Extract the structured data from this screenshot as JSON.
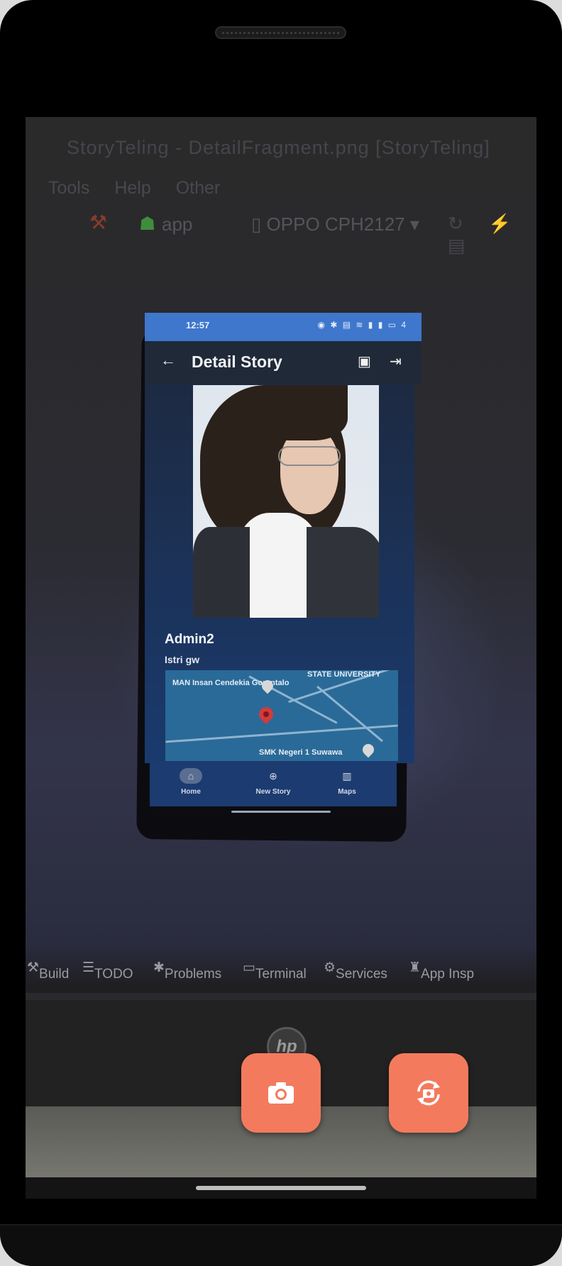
{
  "ide": {
    "title": "StoryTeling - DetailFragment.png [StoryTeling]",
    "menu": [
      "Tools",
      "Help",
      "Other"
    ],
    "run_config": "app",
    "device": "OPPO CPH2127",
    "bottom_tabs": [
      "Build",
      "TODO",
      "Problems",
      "Terminal",
      "Services",
      "App Insp"
    ]
  },
  "phone": {
    "status_time": "12:57",
    "status_icons": "◉ ✱ ▤ ≋ ▮ ▮ ▭ 4",
    "app_title": "Detail Story",
    "back_icon": "arrow-back-icon",
    "story_name": "Admin2",
    "story_desc": "Istri gw",
    "map_labels": [
      "MAN Insan Cendekia Gorontalo",
      "STATE UNIVERSITY",
      "SMK Negeri 1 Suwawa"
    ],
    "nav": [
      {
        "label": "Home",
        "icon": "home-icon",
        "active": true
      },
      {
        "label": "New Story",
        "icon": "add-circle-icon",
        "active": false
      },
      {
        "label": "Maps",
        "icon": "map-icon",
        "active": false
      }
    ]
  },
  "laptop": {
    "logo": "hp"
  },
  "camera_controls": {
    "shutter_icon": "camera-icon",
    "switch_icon": "camera-switch-icon",
    "accent": "#f47a5e"
  }
}
